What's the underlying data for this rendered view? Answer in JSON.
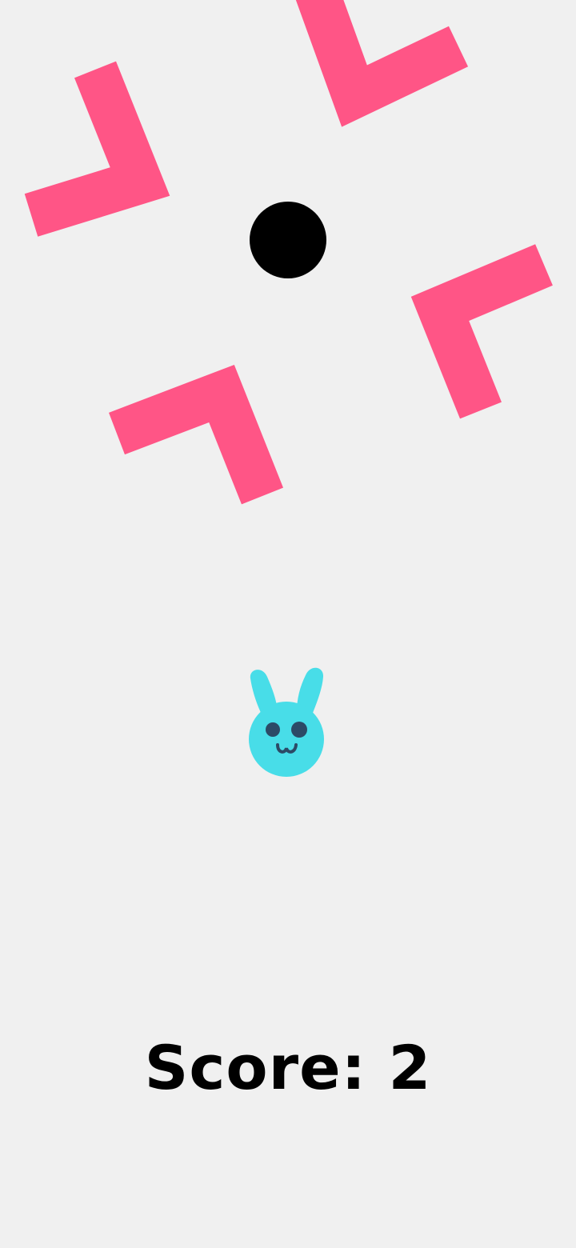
{
  "game": {
    "score_label": "Score: 2"
  },
  "colors": {
    "background": "#f0f0f0",
    "obstacle": "#ff5586",
    "ball": "#000000",
    "bunny_body": "#48dde8",
    "bunny_features": "#2c4a66",
    "score_text": "#000000"
  },
  "icons": {
    "player": "bunny-icon",
    "ball": "ball-icon",
    "obstacle": "chevron-obstacle"
  }
}
